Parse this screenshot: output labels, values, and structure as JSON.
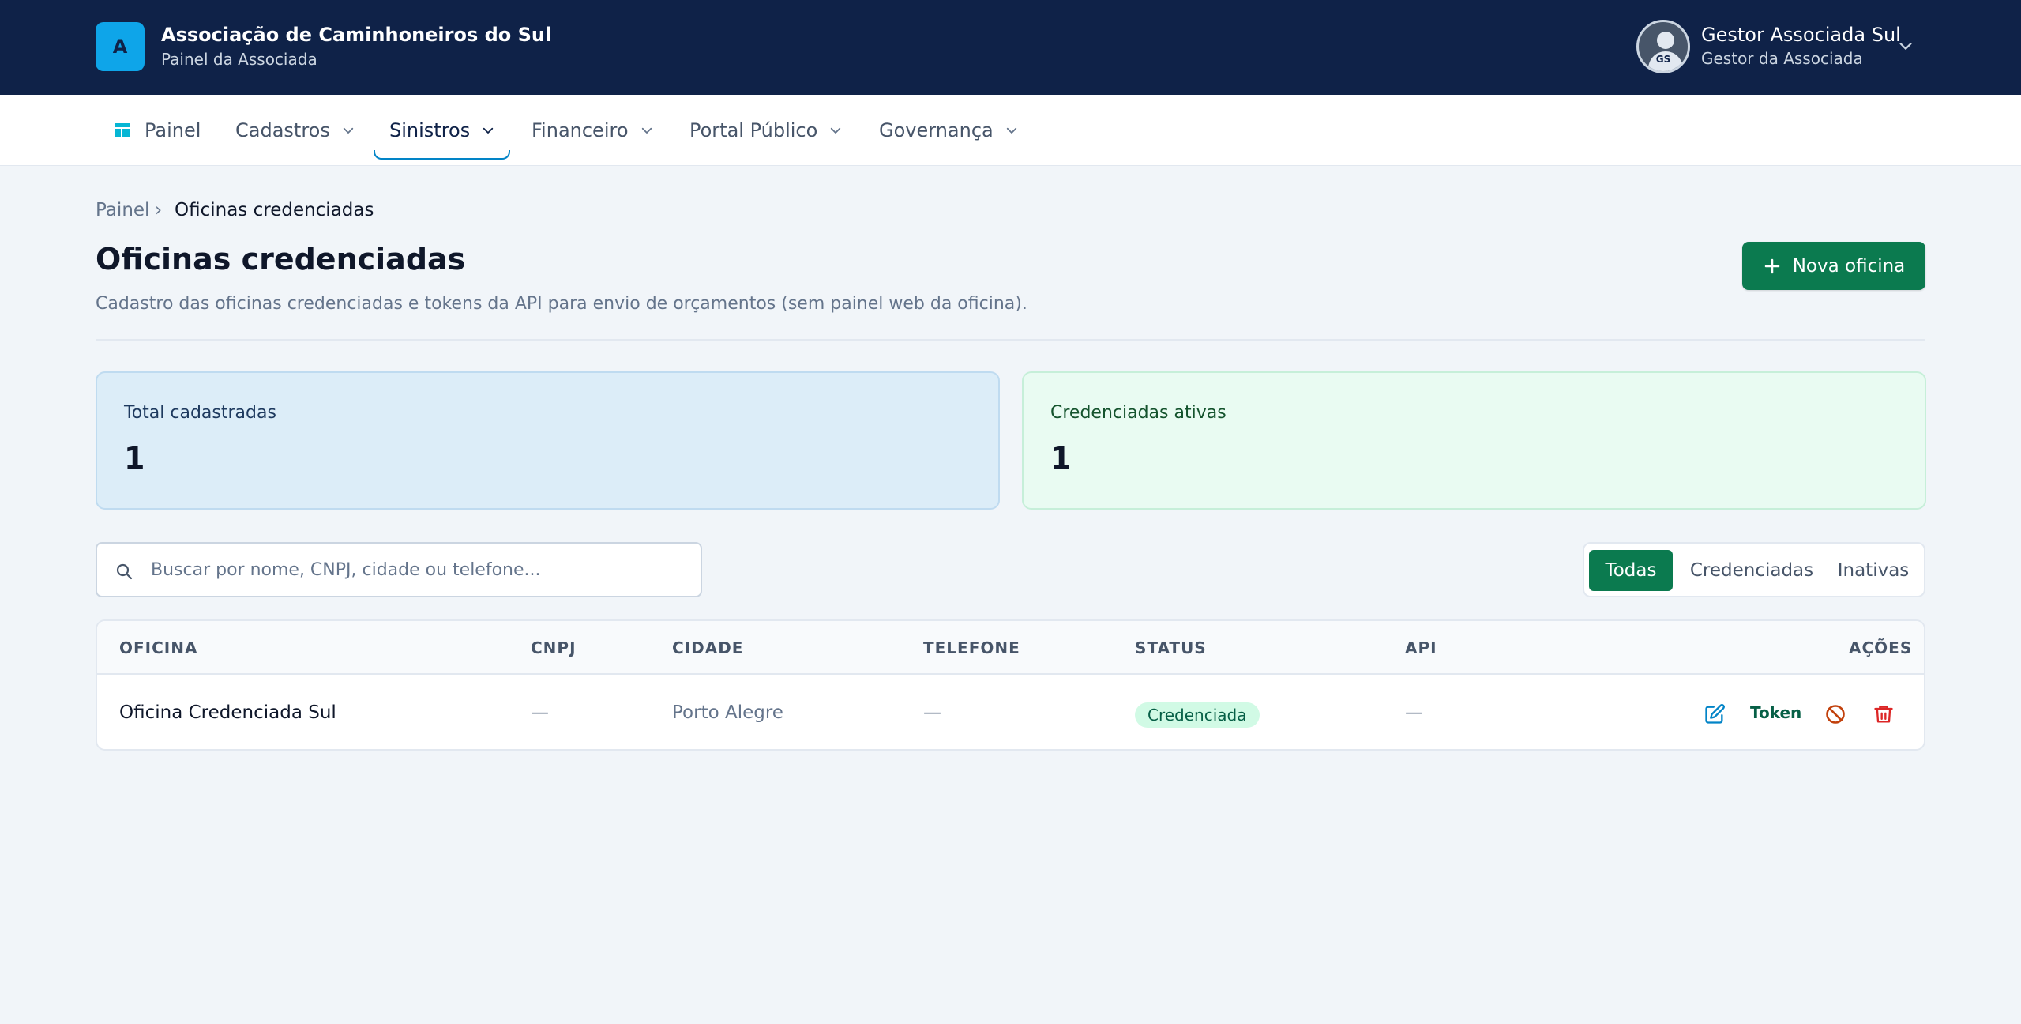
{
  "brand": {
    "logo_letter": "A",
    "name": "Associação de Caminhoneiros do Sul",
    "subtitle": "Painel da Associada"
  },
  "user": {
    "initials": "GS",
    "name": "Gestor Associada Sul",
    "role": "Gestor da Associada"
  },
  "nav": {
    "items": [
      {
        "label": "Painel",
        "icon": "dashboard-icon"
      },
      {
        "label": "Cadastros"
      },
      {
        "label": "Sinistros",
        "active": true
      },
      {
        "label": "Financeiro"
      },
      {
        "label": "Portal Público"
      },
      {
        "label": "Governança"
      }
    ]
  },
  "breadcrumb": {
    "home": "Painel",
    "separator": "›",
    "current": "Oficinas credenciadas"
  },
  "page": {
    "title": "Oficinas credenciadas",
    "description": "Cadastro das oficinas credenciadas e tokens da API para envio de orçamentos (sem painel web da oficina).",
    "new_button": "Nova oficina"
  },
  "stats": [
    {
      "label": "Total cadastradas",
      "value": "1"
    },
    {
      "label": "Credenciadas ativas",
      "value": "1"
    }
  ],
  "search": {
    "placeholder": "Buscar por nome, CNPJ, cidade ou telefone...",
    "value": ""
  },
  "filters": {
    "items": [
      "Todas",
      "Credenciadas",
      "Inativas"
    ],
    "selected": "Todas"
  },
  "table": {
    "columns": [
      "OFICINA",
      "CNPJ",
      "CIDADE",
      "TELEFONE",
      "STATUS",
      "API",
      "AÇÕES"
    ],
    "rows": [
      {
        "oficina": "Oficina Credenciada Sul",
        "cnpj": "—",
        "cidade": "Porto Alegre",
        "telefone": "—",
        "status": "Credenciada",
        "api": "—",
        "token_label": "Token"
      }
    ]
  },
  "colors": {
    "header_bg": "#0f2248",
    "accent_green": "#0b7a4f",
    "accent_blue": "#0284c7",
    "danger": "#dc2626",
    "warning": "#c2410c"
  }
}
